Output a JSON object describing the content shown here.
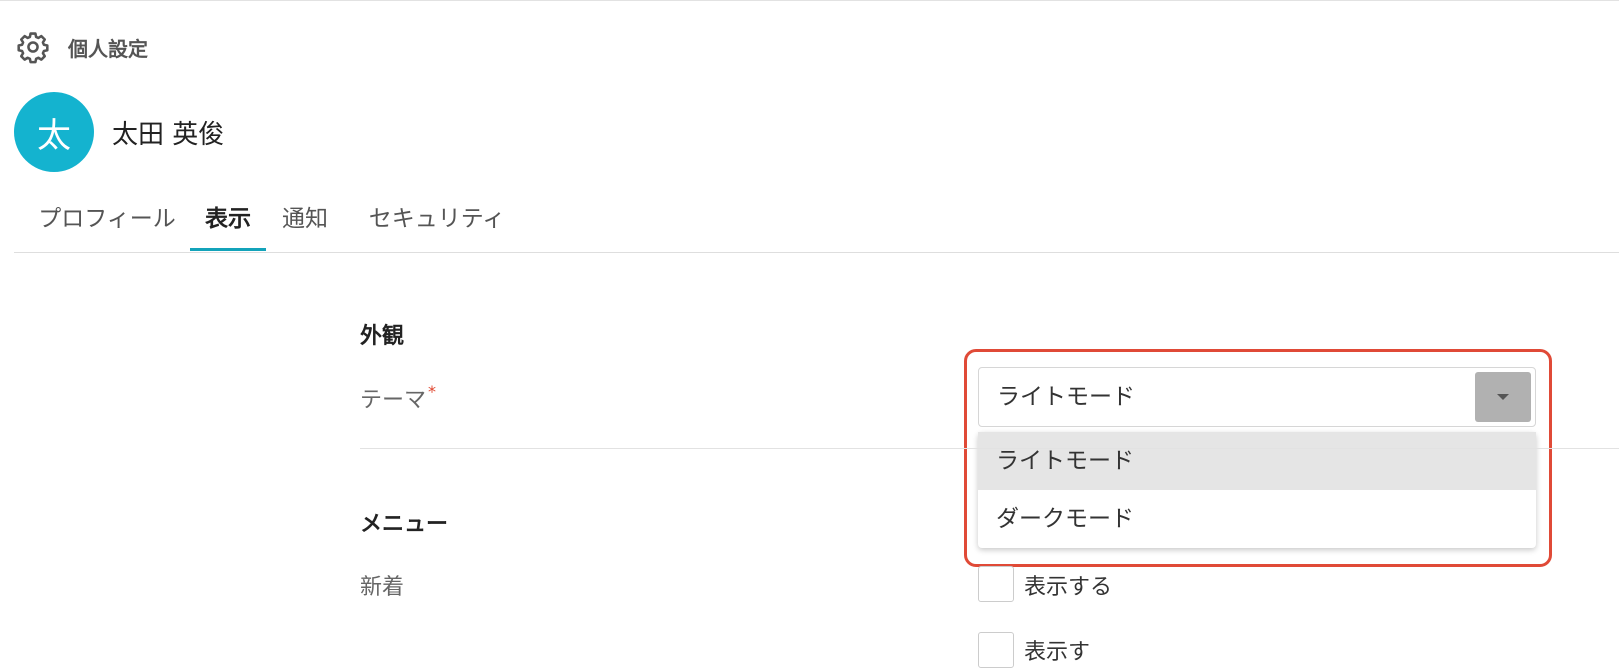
{
  "page": {
    "title": "個人設定",
    "icon": "gear-icon"
  },
  "user": {
    "avatar_initial": "太",
    "avatar_color": "#14b3cf",
    "name": "太田 英俊"
  },
  "tabs": [
    {
      "label": "プロフィール",
      "active": false
    },
    {
      "label": "表示",
      "active": true
    },
    {
      "label": "通知",
      "active": false
    },
    {
      "label": "セキュリティ",
      "active": false
    }
  ],
  "appearance": {
    "section_title": "外観",
    "theme_label": "テーマ",
    "required_mark": "*",
    "theme_value": "ライトモード",
    "theme_options": [
      "ライトモード",
      "ダークモード"
    ]
  },
  "menu": {
    "section_title": "メニュー",
    "new_label": "新着",
    "show_label": "表示する",
    "partial_show_label": "表示す"
  },
  "colors": {
    "accent": "#13a3ba",
    "highlight_frame": "#e04a37",
    "required": "#e0462f"
  }
}
